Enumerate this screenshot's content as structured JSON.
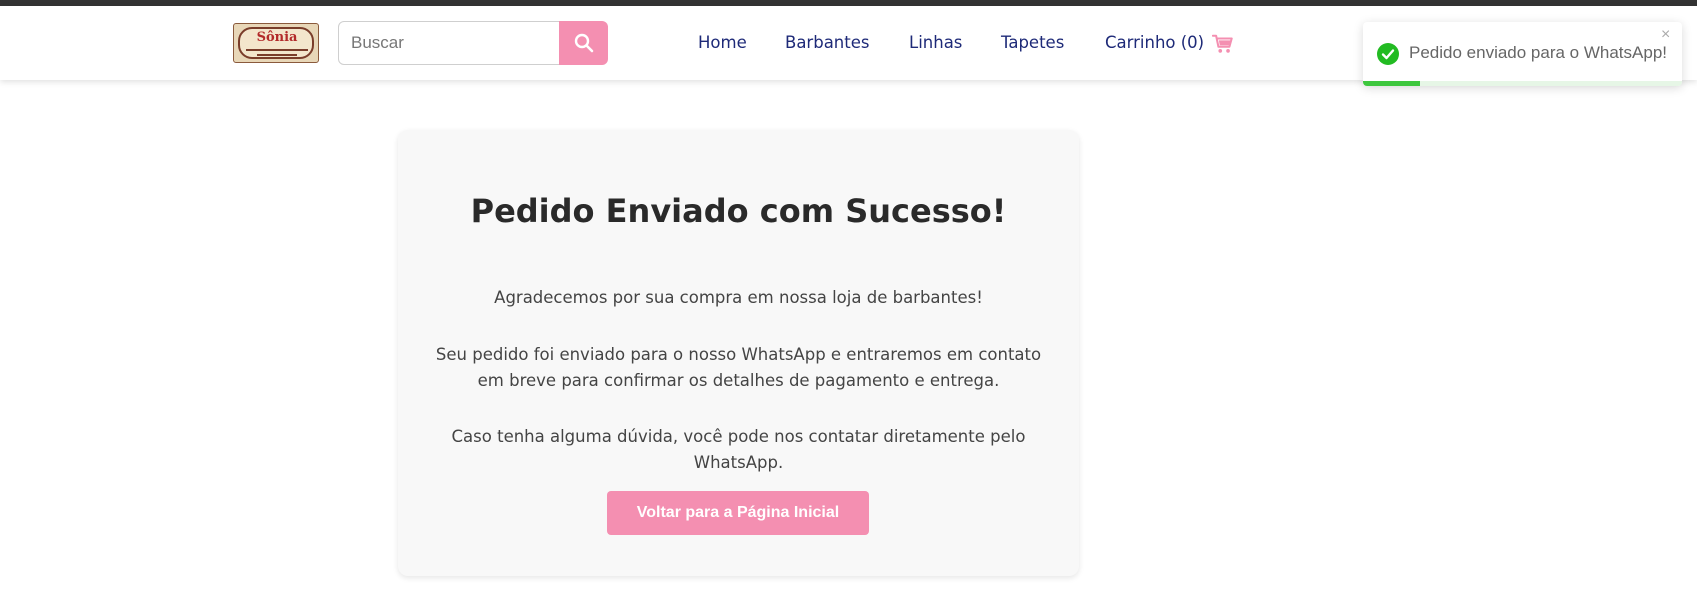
{
  "header": {
    "logo_text": "Sônia",
    "search": {
      "placeholder": "Buscar"
    },
    "nav": [
      {
        "label": "Home"
      },
      {
        "label": "Barbantes"
      },
      {
        "label": "Linhas"
      },
      {
        "label": "Tapetes"
      },
      {
        "label": "Carrinho (0)"
      }
    ],
    "icons": {
      "search": "search-icon",
      "cart": "cart-icon"
    }
  },
  "main": {
    "title": "Pedido Enviado com Sucesso!",
    "paragraphs": [
      "Agradecemos por sua compra em nossa loja de barbantes!",
      "Seu pedido foi enviado para o nosso WhatsApp e entraremos em contato em breve para confirmar os detalhes de pagamento e entrega.",
      "Caso tenha alguma dúvida, você pode nos contatar diretamente pelo WhatsApp."
    ],
    "back_button_label": "Voltar para a Página Inicial"
  },
  "toast": {
    "message": "Pedido enviado para o WhatsApp!",
    "close_symbol": "×",
    "progress": 0.18,
    "icon": "check-circle-icon"
  },
  "colors": {
    "accent_pink": "#f48fb1",
    "nav_blue": "#1e2a78",
    "success_green": "#22bb22",
    "top_bar": "#333333"
  }
}
